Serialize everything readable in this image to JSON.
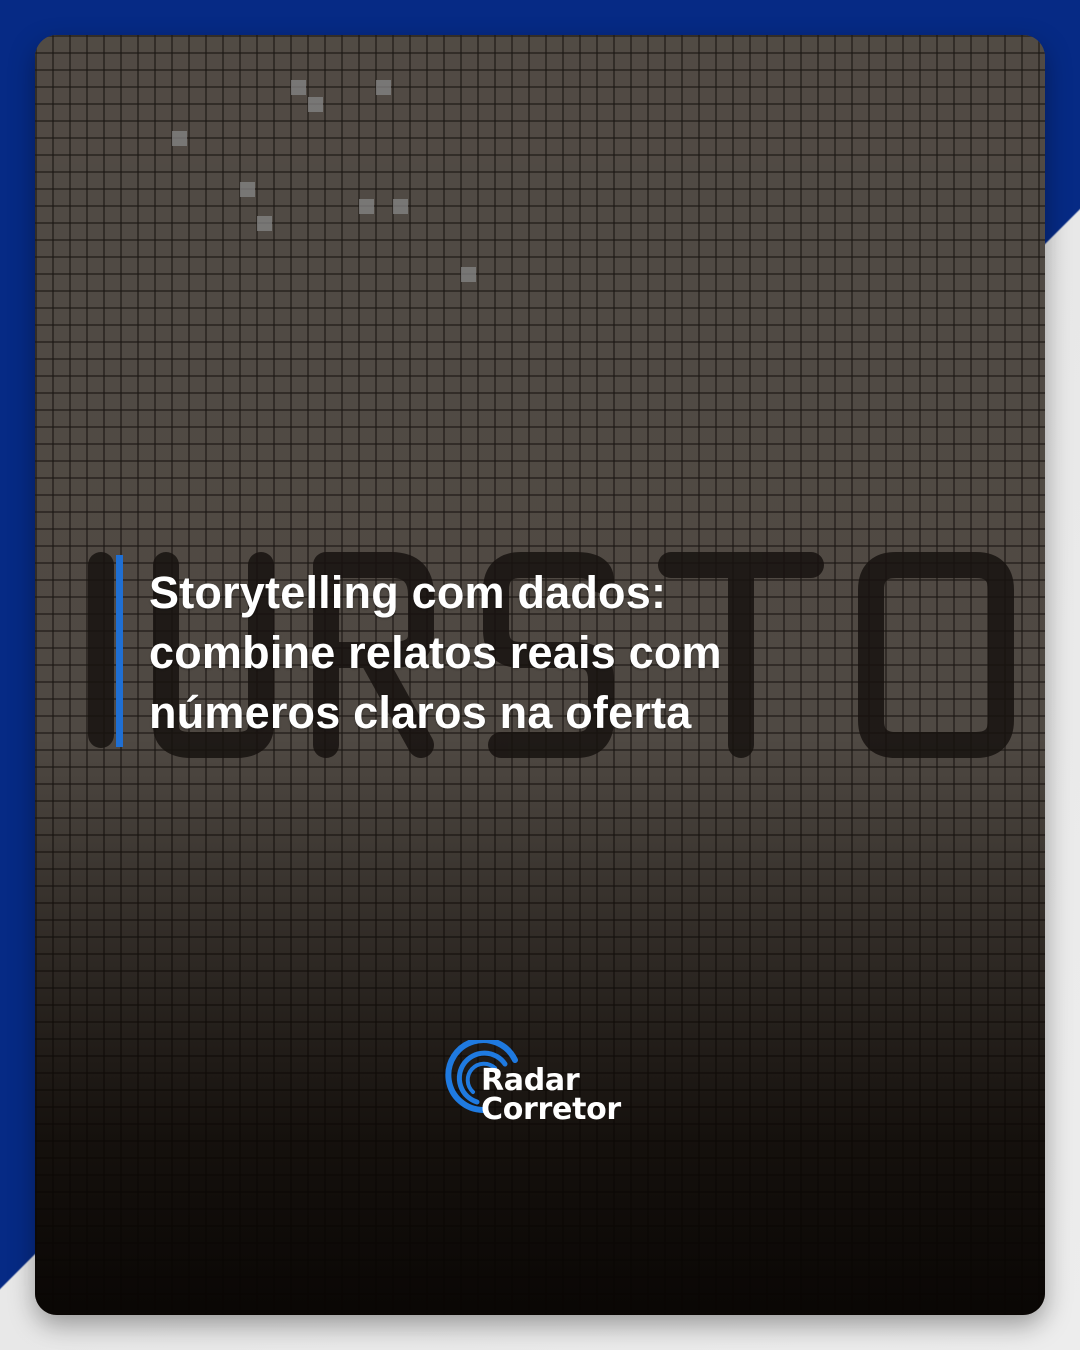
{
  "post": {
    "headline": "Storytelling com dados: combine relatos reais com números claros na oferta"
  },
  "brand": {
    "line1": "Radar",
    "line2": "Corretor",
    "icon": "radar-waves-icon",
    "accent_color": "#1f6fd3",
    "background_color": "#062a85"
  },
  "background_image": {
    "description_icon": "mosaic-tile-wall"
  }
}
